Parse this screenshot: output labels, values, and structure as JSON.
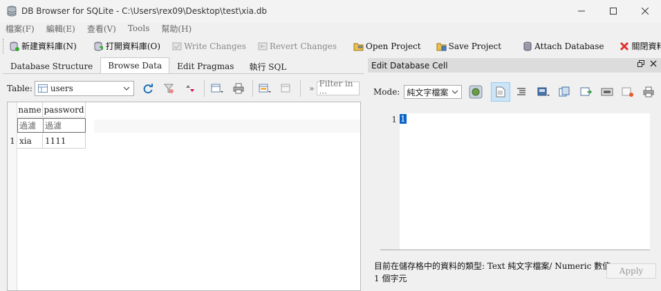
{
  "window": {
    "title": "DB Browser for SQLite - C:\\Users\\rex09\\Desktop\\test\\xia.db",
    "minimize": "—",
    "maximize": "☐",
    "close": "✕"
  },
  "menu": [
    "檔案(F)",
    "編輯(E)",
    "查看(V)",
    "Tools",
    "幫助(H)"
  ],
  "toolbar": {
    "new_db": "新建資料庫(N)",
    "open_db": "打開資料庫(O)",
    "write_changes": "Write Changes",
    "revert_changes": "Revert Changes",
    "open_project": "Open Project",
    "save_project": "Save Project",
    "attach_db": "Attach Database",
    "close_db": "關閉資料庫(C)"
  },
  "tabs": [
    "Database Structure",
    "Browse Data",
    "Edit Pragmas",
    "執行 SQL"
  ],
  "active_tab": "Browse Data",
  "browse": {
    "table_label": "Table:",
    "table_value": "users",
    "filter_more": "»",
    "filter_placeholder": "Filter in ···"
  },
  "grid": {
    "columns": [
      "name",
      "password"
    ],
    "filter_placeholder": "過濾",
    "rows": [
      {
        "num": "1",
        "cells": [
          "xia",
          "1111"
        ]
      }
    ]
  },
  "edit_cell": {
    "title": "Edit Database Cell",
    "mode_label": "Mode:",
    "mode_value": "純文字檔案",
    "line_number": "1",
    "content": "1",
    "status_type": "目前在儲存格中的資料的類型: Text 純文字檔案/ Numeric 數值",
    "status_size": "1 個字元",
    "apply": "Apply"
  },
  "colors": {
    "accent": "#0a64c8",
    "close_red": "#e0312b",
    "refresh_blue": "#1f6fb8"
  }
}
